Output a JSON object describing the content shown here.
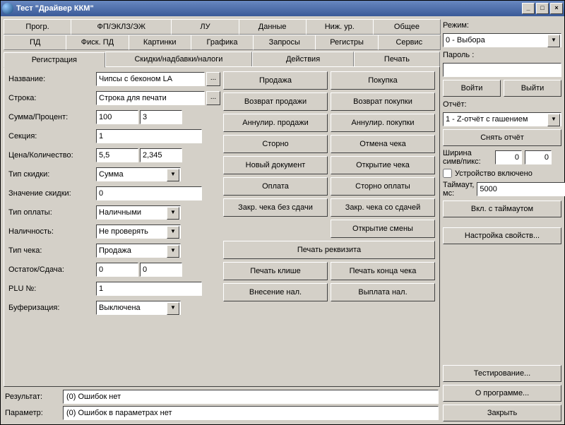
{
  "title": "Тест \"Драйвер ККМ\"",
  "menu1": [
    "Прогр.",
    "ФП/ЭКЛЗ/ЭЖ",
    "ЛУ",
    "Данные",
    "Ниж. ур.",
    "Общее"
  ],
  "menu2": [
    "ПД",
    "Фиск. ПД",
    "Картинки",
    "Графика",
    "Запросы",
    "Регистры",
    "Сервис"
  ],
  "tabs": [
    "Регистрация",
    "Скидки/надбавки/налоги",
    "Действия",
    "Печать"
  ],
  "form": {
    "name_lbl": "Название:",
    "name_val": "Чипсы с беконом LA",
    "line_lbl": "Строка:",
    "line_val": "Строка для печати",
    "sum_lbl": "Сумма/Процент:",
    "sum_val1": "100",
    "sum_val2": "3",
    "section_lbl": "Секция:",
    "section_val": "1",
    "price_lbl": "Цена/Количество:",
    "price_val1": "5,5",
    "price_val2": "2,345",
    "disc_type_lbl": "Тип скидки:",
    "disc_type_val": "Сумма",
    "disc_val_lbl": "Значение скидки:",
    "disc_val": "0",
    "pay_type_lbl": "Тип оплаты:",
    "pay_type_val": "Наличными",
    "cash_lbl": "Наличность:",
    "cash_val": "Не проверять",
    "check_type_lbl": "Тип чека:",
    "check_type_val": "Продажа",
    "rest_lbl": "Остаток/Сдача:",
    "rest_val1": "0",
    "rest_val2": "0",
    "plu_lbl": "PLU №:",
    "plu_val": "1",
    "buf_lbl": "Буферизация:",
    "buf_val": "Выключена"
  },
  "actions_left": [
    "Продажа",
    "Возврат продажи",
    "Аннулир. продажи",
    "Сторно",
    "Новый документ",
    "Оплата",
    "Закр. чека без сдачи"
  ],
  "actions_right": [
    "Покупка",
    "Возврат покупки",
    "Аннулир. покупки",
    "Отмена чека",
    "Открытие чека",
    "Сторно оплаты",
    "Закр. чека со сдачей",
    "Открытие смены"
  ],
  "wide1": "Печать реквизита",
  "row_bottom_l": [
    "Печать клише",
    "Внесение нал."
  ],
  "row_bottom_r": [
    "Печать конца чека",
    "Выплата нал."
  ],
  "right": {
    "mode_lbl": "Режим:",
    "mode_val": "0 - Выбора",
    "pass_lbl": "Пароль :",
    "login": "Войти",
    "logout": "Выйти",
    "report_lbl": "Отчёт:",
    "report_val": "1 - Z-отчёт с гашением",
    "report_btn": "Снять отчёт",
    "width_lbl": "Ширина симв/пикс:",
    "w1": "0",
    "w2": "0",
    "dev_on": "Устройство включено",
    "timeout_lbl": "Таймаут, мс:",
    "timeout_val": "5000",
    "timeout_btn": "Вкл. с таймаутом",
    "props": "Настройка свойств...",
    "test": "Тестирование...",
    "about": "О программе...",
    "close": "Закрыть"
  },
  "footer": {
    "result_lbl": "Результат:",
    "result_val": "(0) Ошибок нет",
    "param_lbl": "Параметр:",
    "param_val": "(0) Ошибок в параметрах нет"
  }
}
